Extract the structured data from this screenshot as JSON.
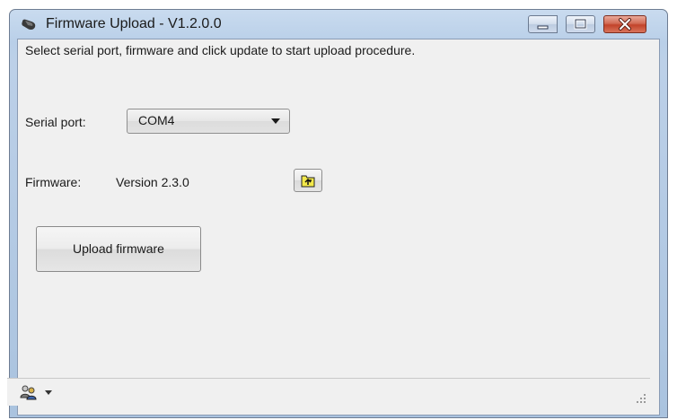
{
  "window": {
    "title": "Firmware Upload - V1.2.0.0",
    "app_icon": "hand-icon",
    "buttons": {
      "minimize": "minimize-icon",
      "maximize": "maximize-icon",
      "close": "close-icon"
    },
    "colors": {
      "close_button": "#c2432a",
      "client_background": "#f0f0f0"
    }
  },
  "main": {
    "instruction": "Select serial port, firmware and click update to start upload procedure.",
    "serial_port": {
      "label": "Serial port:",
      "selected": "COM4"
    },
    "firmware": {
      "label": "Firmware:",
      "value": "Version 2.3.0",
      "browse_icon": "folder-up-icon"
    },
    "upload_button_label": "Upload firmware"
  },
  "statusbar": {
    "icon": "users-icon",
    "dropdown_icon": "chevron-down-icon"
  }
}
